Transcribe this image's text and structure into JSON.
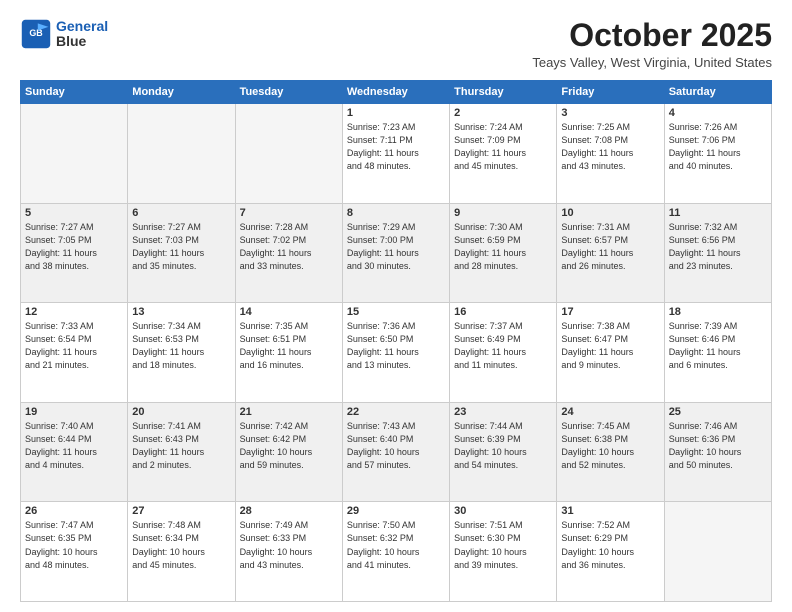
{
  "header": {
    "logo_line1": "General",
    "logo_line2": "Blue",
    "month": "October 2025",
    "location": "Teays Valley, West Virginia, United States"
  },
  "days_of_week": [
    "Sunday",
    "Monday",
    "Tuesday",
    "Wednesday",
    "Thursday",
    "Friday",
    "Saturday"
  ],
  "weeks": [
    [
      {
        "day": "",
        "info": ""
      },
      {
        "day": "",
        "info": ""
      },
      {
        "day": "",
        "info": ""
      },
      {
        "day": "1",
        "info": "Sunrise: 7:23 AM\nSunset: 7:11 PM\nDaylight: 11 hours\nand 48 minutes."
      },
      {
        "day": "2",
        "info": "Sunrise: 7:24 AM\nSunset: 7:09 PM\nDaylight: 11 hours\nand 45 minutes."
      },
      {
        "day": "3",
        "info": "Sunrise: 7:25 AM\nSunset: 7:08 PM\nDaylight: 11 hours\nand 43 minutes."
      },
      {
        "day": "4",
        "info": "Sunrise: 7:26 AM\nSunset: 7:06 PM\nDaylight: 11 hours\nand 40 minutes."
      }
    ],
    [
      {
        "day": "5",
        "info": "Sunrise: 7:27 AM\nSunset: 7:05 PM\nDaylight: 11 hours\nand 38 minutes."
      },
      {
        "day": "6",
        "info": "Sunrise: 7:27 AM\nSunset: 7:03 PM\nDaylight: 11 hours\nand 35 minutes."
      },
      {
        "day": "7",
        "info": "Sunrise: 7:28 AM\nSunset: 7:02 PM\nDaylight: 11 hours\nand 33 minutes."
      },
      {
        "day": "8",
        "info": "Sunrise: 7:29 AM\nSunset: 7:00 PM\nDaylight: 11 hours\nand 30 minutes."
      },
      {
        "day": "9",
        "info": "Sunrise: 7:30 AM\nSunset: 6:59 PM\nDaylight: 11 hours\nand 28 minutes."
      },
      {
        "day": "10",
        "info": "Sunrise: 7:31 AM\nSunset: 6:57 PM\nDaylight: 11 hours\nand 26 minutes."
      },
      {
        "day": "11",
        "info": "Sunrise: 7:32 AM\nSunset: 6:56 PM\nDaylight: 11 hours\nand 23 minutes."
      }
    ],
    [
      {
        "day": "12",
        "info": "Sunrise: 7:33 AM\nSunset: 6:54 PM\nDaylight: 11 hours\nand 21 minutes."
      },
      {
        "day": "13",
        "info": "Sunrise: 7:34 AM\nSunset: 6:53 PM\nDaylight: 11 hours\nand 18 minutes."
      },
      {
        "day": "14",
        "info": "Sunrise: 7:35 AM\nSunset: 6:51 PM\nDaylight: 11 hours\nand 16 minutes."
      },
      {
        "day": "15",
        "info": "Sunrise: 7:36 AM\nSunset: 6:50 PM\nDaylight: 11 hours\nand 13 minutes."
      },
      {
        "day": "16",
        "info": "Sunrise: 7:37 AM\nSunset: 6:49 PM\nDaylight: 11 hours\nand 11 minutes."
      },
      {
        "day": "17",
        "info": "Sunrise: 7:38 AM\nSunset: 6:47 PM\nDaylight: 11 hours\nand 9 minutes."
      },
      {
        "day": "18",
        "info": "Sunrise: 7:39 AM\nSunset: 6:46 PM\nDaylight: 11 hours\nand 6 minutes."
      }
    ],
    [
      {
        "day": "19",
        "info": "Sunrise: 7:40 AM\nSunset: 6:44 PM\nDaylight: 11 hours\nand 4 minutes."
      },
      {
        "day": "20",
        "info": "Sunrise: 7:41 AM\nSunset: 6:43 PM\nDaylight: 11 hours\nand 2 minutes."
      },
      {
        "day": "21",
        "info": "Sunrise: 7:42 AM\nSunset: 6:42 PM\nDaylight: 10 hours\nand 59 minutes."
      },
      {
        "day": "22",
        "info": "Sunrise: 7:43 AM\nSunset: 6:40 PM\nDaylight: 10 hours\nand 57 minutes."
      },
      {
        "day": "23",
        "info": "Sunrise: 7:44 AM\nSunset: 6:39 PM\nDaylight: 10 hours\nand 54 minutes."
      },
      {
        "day": "24",
        "info": "Sunrise: 7:45 AM\nSunset: 6:38 PM\nDaylight: 10 hours\nand 52 minutes."
      },
      {
        "day": "25",
        "info": "Sunrise: 7:46 AM\nSunset: 6:36 PM\nDaylight: 10 hours\nand 50 minutes."
      }
    ],
    [
      {
        "day": "26",
        "info": "Sunrise: 7:47 AM\nSunset: 6:35 PM\nDaylight: 10 hours\nand 48 minutes."
      },
      {
        "day": "27",
        "info": "Sunrise: 7:48 AM\nSunset: 6:34 PM\nDaylight: 10 hours\nand 45 minutes."
      },
      {
        "day": "28",
        "info": "Sunrise: 7:49 AM\nSunset: 6:33 PM\nDaylight: 10 hours\nand 43 minutes."
      },
      {
        "day": "29",
        "info": "Sunrise: 7:50 AM\nSunset: 6:32 PM\nDaylight: 10 hours\nand 41 minutes."
      },
      {
        "day": "30",
        "info": "Sunrise: 7:51 AM\nSunset: 6:30 PM\nDaylight: 10 hours\nand 39 minutes."
      },
      {
        "day": "31",
        "info": "Sunrise: 7:52 AM\nSunset: 6:29 PM\nDaylight: 10 hours\nand 36 minutes."
      },
      {
        "day": "",
        "info": ""
      }
    ]
  ]
}
